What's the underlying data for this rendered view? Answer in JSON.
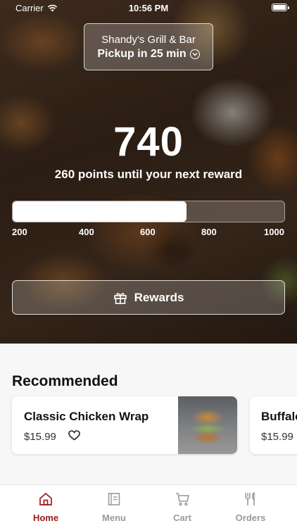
{
  "status_bar": {
    "carrier": "Carrier",
    "time": "10:56 PM"
  },
  "store": {
    "name": "Shandy's Grill & Bar",
    "pickup": "Pickup in 25 min"
  },
  "points": {
    "current": "740",
    "caption": "260 points until your next reward",
    "progress_fraction": 0.64,
    "ticks": [
      "200",
      "400",
      "600",
      "800",
      "1000"
    ]
  },
  "rewards_button": {
    "label": "Rewards"
  },
  "recommended": {
    "title": "Recommended",
    "items": [
      {
        "name": "Classic Chicken Wrap",
        "price": "$15.99"
      },
      {
        "name": "Buffalo",
        "price": "$15.99"
      }
    ]
  },
  "tab_bar": {
    "tabs": [
      {
        "label": "Home",
        "icon": "home-icon"
      },
      {
        "label": "Menu",
        "icon": "menu-icon"
      },
      {
        "label": "Cart",
        "icon": "cart-icon"
      },
      {
        "label": "Orders",
        "icon": "orders-icon"
      }
    ],
    "active_index": 0
  },
  "colors": {
    "accent": "#9b1a1a",
    "inactive": "#9a9a9a"
  }
}
